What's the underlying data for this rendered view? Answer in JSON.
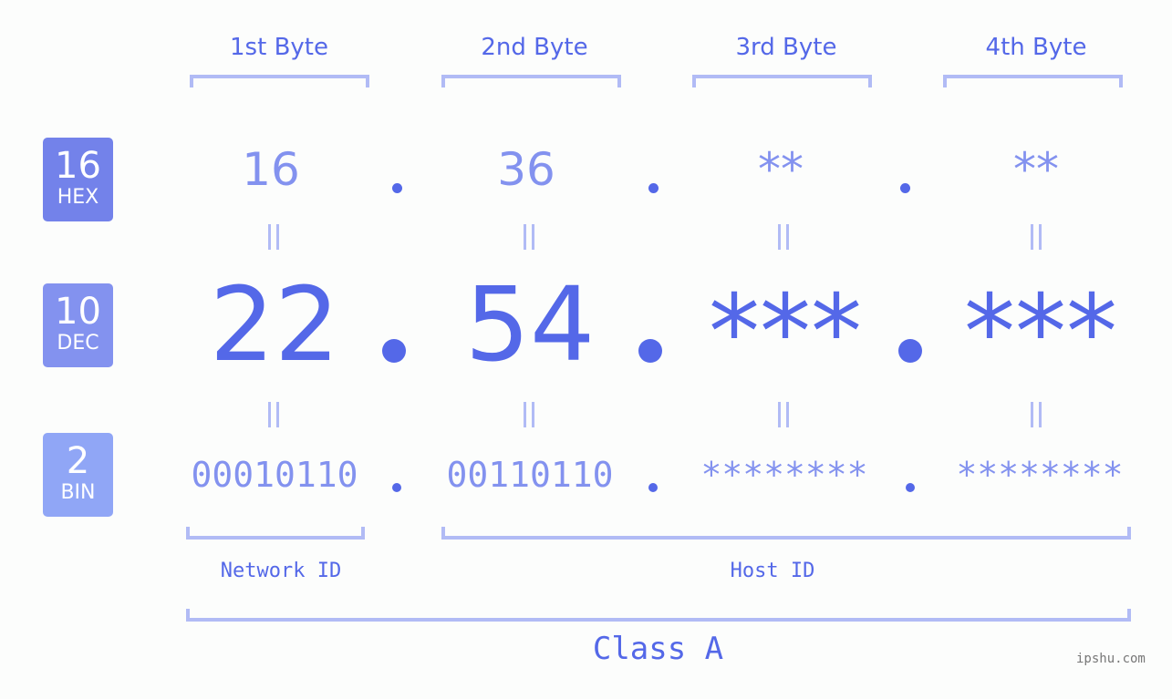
{
  "colors": {
    "hex_badge": "#7382ea",
    "dec_badge": "#8392ef",
    "bin_badge": "#90a6f6",
    "accent": "#5468e8",
    "light_text": "#8392ef",
    "bracket": "#b1bbf5"
  },
  "badges": [
    {
      "number": "16",
      "label": "HEX"
    },
    {
      "number": "10",
      "label": "DEC"
    },
    {
      "number": "2",
      "label": "BIN"
    }
  ],
  "byte_headers": [
    "1st Byte",
    "2nd Byte",
    "3rd Byte",
    "4th Byte"
  ],
  "hex_values": [
    "16",
    "36",
    "**",
    "**"
  ],
  "dec_values": [
    "22",
    "54",
    "***",
    "***"
  ],
  "bin_values": [
    "00010110",
    "00110110",
    "********",
    "********"
  ],
  "network_id_label": "Network ID",
  "host_id_label": "Host ID",
  "class_label": "Class A",
  "watermark": "ipshu.com"
}
